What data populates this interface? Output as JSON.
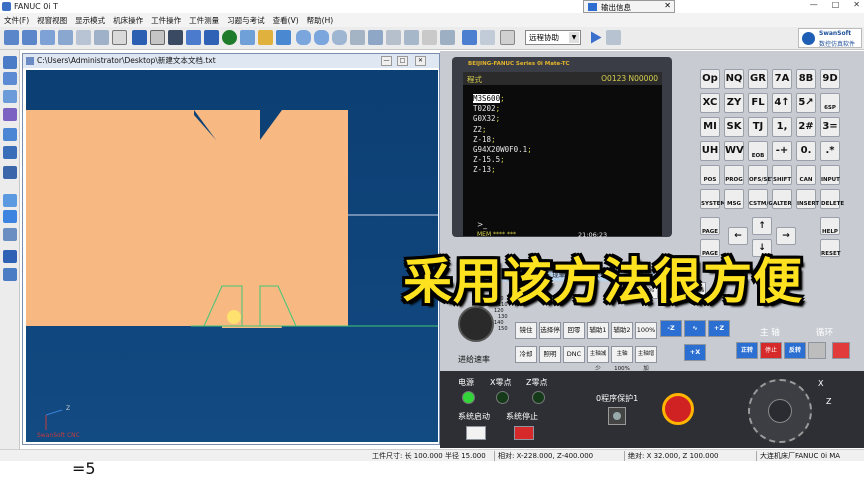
{
  "window": {
    "title": "FANUC 0i T"
  },
  "menu": [
    "文件(F)",
    "视窗视图",
    "显示模式",
    "机床操作",
    "工件操作",
    "工件测量",
    "习题与考试",
    "查看(V)",
    "帮助(H)"
  ],
  "toolbar": {
    "mode_combo": "远程协助"
  },
  "brand_badge": {
    "line1": "SwanSoft",
    "line2": "数控仿真软件"
  },
  "info_window": {
    "title": "输出信息"
  },
  "viewport": {
    "title": "C:\\Users\\Administrator\\Desktop\\新建文本文档.txt",
    "axis_label": "SwanSoft CNC",
    "axis_z": "Z"
  },
  "cnc": {
    "brand": "BEIJING-FANUC Series 0i Mate-TC",
    "screen_mode": "程式",
    "program_no": "O0123 N00000",
    "program_lines": [
      {
        "text": "M3S600",
        "end": ";",
        "hl": true
      },
      {
        "text": "T0202",
        "end": ";"
      },
      {
        "text": "G0X32",
        "end": ";"
      },
      {
        "text": "Z2",
        "end": ";"
      },
      {
        "text": "Z-18",
        "end": ";"
      },
      {
        "text": "G94X20W0F0.1",
        "end": ";"
      },
      {
        "text": "Z-15.5",
        "end": ";"
      },
      {
        "text": "Z-13",
        "end": ";"
      }
    ],
    "prompt": ">_",
    "status_mode": "MEM **** ***",
    "time": "21:06:23",
    "softkeys": [
      "程序",
      "检视",
      "现单节",
      "次单节",
      "操作"
    ],
    "keypad": [
      [
        "Op",
        "NQ",
        "GR",
        "7A",
        "8B",
        "9D"
      ],
      [
        "XC",
        "ZY",
        "FL",
        "4↑",
        "5↗",
        "6SP"
      ],
      [
        "MI",
        "SK",
        "TJ",
        "1,",
        "2#",
        "3="
      ],
      [
        "UH",
        "WV",
        "EOB",
        "-+",
        "0.",
        ".*"
      ],
      [
        "POS",
        "PROG",
        "OFS/SET",
        "SHIFT",
        "CAN",
        "INPUT"
      ],
      [
        "SYSTEM",
        "MSG",
        "CSTM/GR",
        "ALTER",
        "INSERT",
        "DELETE"
      ]
    ],
    "page_keys": [
      "PAGE",
      "PAGE",
      "HELP",
      "RESET"
    ],
    "override_labels": [
      "FO",
      "25%",
      "50%",
      "100%"
    ],
    "func_buttons_row1": [
      "镜住",
      "选择停",
      "回零",
      "辅助1",
      "辅助2",
      "100%"
    ],
    "func_buttons_row2": [
      "冷却",
      "照明",
      "DNC",
      "主轴减少",
      "主轴100%",
      "主轴增加"
    ],
    "feed_label": "进给速率",
    "jog_buttons": [
      "-Z",
      "∿",
      "+Z",
      "+X"
    ],
    "spindle_label": "主 轴",
    "cycle_label": "循环",
    "spindle_buttons": [
      "正转",
      "停止",
      "反转"
    ],
    "feed_dial_values": [
      "100",
      "110",
      "120",
      "130",
      "140",
      "150"
    ],
    "lamps": {
      "power": "电源",
      "x_zero": "X零点",
      "z_zero": "Z零点"
    },
    "sys_start": "系统启动",
    "sys_stop": "系统停止",
    "program_protect": "0程序保护1",
    "handwheel_axis_x": "X",
    "handwheel_axis_z": "Z"
  },
  "statusbar": {
    "workpiece": "工件尺寸: 长 100.000 半径 15.000",
    "relative": "相对: X-228.000, Z-400.000",
    "absolute": "绝对: X  32.000, Z 100.000",
    "machine": "大连机床厂FANUC 0i MA"
  },
  "below_text": "=5",
  "subtitle": "采用该方法很方便",
  "colors": {
    "workpiece": "#f7b882",
    "scene_bg": "#103c6c",
    "subtitle": "#ffe21f",
    "lcd_text": "#d9d24e"
  }
}
